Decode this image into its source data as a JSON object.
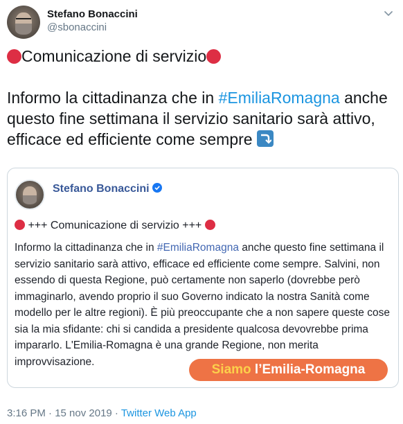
{
  "tweet": {
    "display_name": "Stefano Bonaccini",
    "handle": "@sbonaccini",
    "title_text": "Comunicazione di servizio",
    "body_before": "Informo la cittadinanza che in ",
    "hashtag": "#EmiliaRomagna",
    "body_after": " anche questo fine settimana il servizio sanitario sarà attivo, efficace ed efficiente come sempre",
    "arrow_icon": "arrow-right-curving-down-icon"
  },
  "card": {
    "author": "Stefano Bonaccini",
    "title": " +++ Comunicazione di servizio +++ ",
    "body_before": "Informo la cittadinanza che in ",
    "hashtag": "#EmiliaRomagna",
    "body_after": " anche questo fine settimana il servizio sanitario sarà attivo, efficace ed efficiente come sempre. Salvini, non essendo di questa Regione, può certamente non saperlo (dovrebbe però immaginarlo, avendo proprio il suo Governo indicato la nostra Sanità come modello per le altre regioni). È più preoccupante che a non sapere queste cose sia la mia sfidante: chi si candida a presidente qualcosa devovrebbe prima impararlo. L'Emilia-Romagna è una grande Regione, non merita improvvisazione.",
    "banner_siamo": "Siamo",
    "banner_rest": " l’Emilia-Romagna"
  },
  "meta": {
    "timestamp": "3:16 PM · 15 nov 2019 · ",
    "source": "Twitter Web App"
  },
  "colors": {
    "link": "#1b95e0",
    "red_dot": "#dd2e44",
    "banner": "#ee7345",
    "banner_accent": "#fcd04b"
  }
}
